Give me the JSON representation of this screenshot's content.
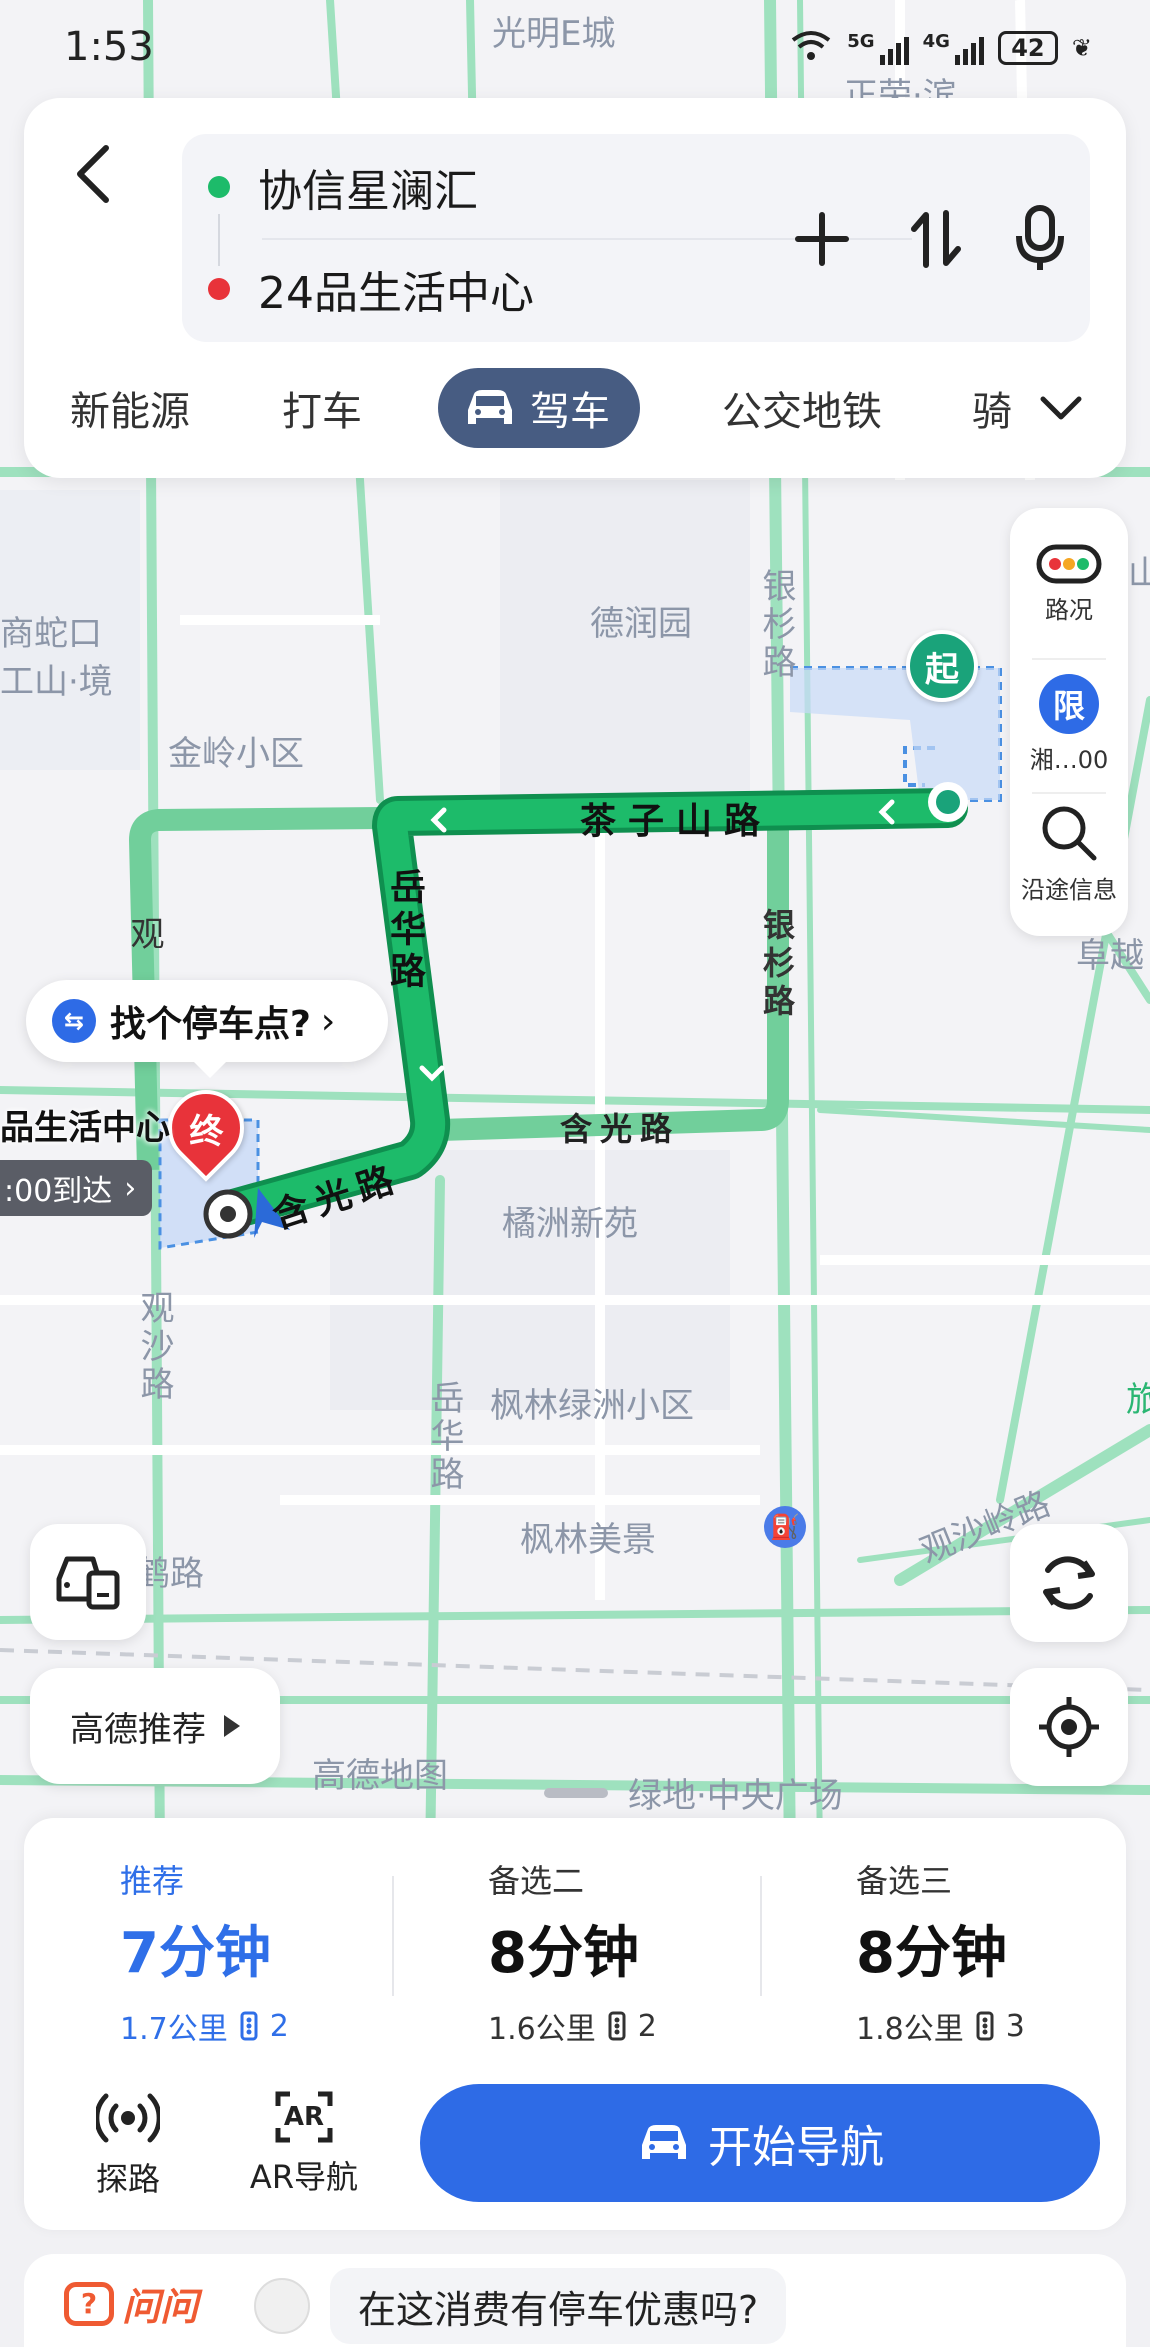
{
  "status_bar": {
    "time": "1:53",
    "signal_1": "5G",
    "signal_2": "4G",
    "battery": "42"
  },
  "search": {
    "origin": "协信星澜汇",
    "destination": "24品生活中心",
    "icons": [
      "back-icon",
      "plus-icon",
      "swap-icon",
      "microphone-icon"
    ]
  },
  "mode_tabs": [
    {
      "label": "新能源",
      "active": false
    },
    {
      "label": "打车",
      "active": false
    },
    {
      "label": "驾车",
      "active": true,
      "icon": "car-icon"
    },
    {
      "label": "公交地铁",
      "active": false
    },
    {
      "label": "骑",
      "active": false
    }
  ],
  "map": {
    "labels": [
      "光明E城",
      "正荣·滨",
      "德润园",
      "商蛇口",
      "工山·境",
      "金岭小区",
      "橘洲新苑",
      "枫林绿洲小区",
      "枫林美景",
      "高德地图",
      "绿地·中央广场",
      "阜越",
      "旅",
      "山"
    ],
    "roads": [
      "茶子山路",
      "岳华路",
      "含光路",
      "银杉路",
      "银杉路",
      "观沙路",
      "观沙岭路",
      "岳华路",
      "观",
      "鹤路",
      "观沙路"
    ],
    "start_marker": "起",
    "end_marker": "终",
    "parking_prompt": "找个停车点?",
    "destination_label": "品生活中心",
    "arrival_label": ":00到达"
  },
  "map_controls": {
    "traffic_label": "路况",
    "restriction_badge": "限",
    "restriction_label": "湘…00",
    "along_route_label": "沿途信息",
    "recommend_label": "高德推荐"
  },
  "route_options": [
    {
      "tag": "推荐",
      "time": "7分钟",
      "distance": "1.7公里",
      "lights": "2",
      "selected": true
    },
    {
      "tag": "备选二",
      "time": "8分钟",
      "distance": "1.6公里",
      "lights": "2",
      "selected": false
    },
    {
      "tag": "备选三",
      "time": "8分钟",
      "distance": "1.8公里",
      "lights": "3",
      "selected": false
    }
  ],
  "bottom_actions": {
    "explore_label": "探路",
    "ar_label": "AR导航",
    "ar_badge": "AR",
    "start_label": "开始导航"
  },
  "ask": {
    "logo": "问问",
    "question": "在这消费有停车优惠吗?"
  },
  "colors": {
    "route_green": "#1dbb6a",
    "accent_blue": "#2e6be6",
    "end_red": "#e8333a",
    "start_teal": "#1aa37a",
    "tab_active": "#475c82"
  }
}
